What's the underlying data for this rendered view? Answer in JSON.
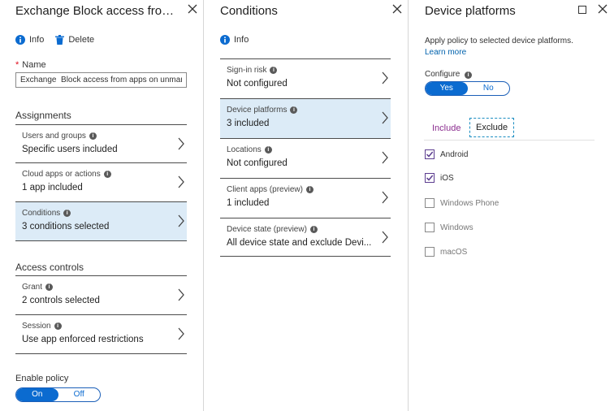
{
  "blade1": {
    "title": "Exchange Block access from a...",
    "commands": {
      "info": "Info",
      "delete": "Delete"
    },
    "name_label": "Name",
    "name_value": "Exchange  Block access from apps on unman...",
    "assignments_header": "Assignments",
    "assignments": [
      {
        "label": "Users and groups",
        "value": "Specific users included"
      },
      {
        "label": "Cloud apps or actions",
        "value": "1 app included"
      },
      {
        "label": "Conditions",
        "value": "3 conditions selected"
      }
    ],
    "access_header": "Access controls",
    "access": [
      {
        "label": "Grant",
        "value": "2 controls selected"
      },
      {
        "label": "Session",
        "value": "Use app enforced restrictions"
      }
    ],
    "enable_label": "Enable policy",
    "toggle": {
      "on": "On",
      "off": "Off"
    }
  },
  "blade2": {
    "title": "Conditions",
    "commands": {
      "info": "Info"
    },
    "rows": [
      {
        "label": "Sign-in risk",
        "value": "Not configured"
      },
      {
        "label": "Device platforms",
        "value": "3 included"
      },
      {
        "label": "Locations",
        "value": "Not configured"
      },
      {
        "label": "Client apps (preview)",
        "value": "1 included"
      },
      {
        "label": "Device state (preview)",
        "value": "All device state and exclude Devi..."
      }
    ]
  },
  "blade3": {
    "title": "Device platforms",
    "description": "Apply policy to selected device platforms.",
    "learn_more": "Learn more",
    "configure_label": "Configure",
    "toggle": {
      "yes": "Yes",
      "no": "No"
    },
    "tabs": {
      "include": "Include",
      "exclude": "Exclude"
    },
    "platforms": [
      {
        "label": "Android",
        "checked": true
      },
      {
        "label": "iOS",
        "checked": true
      },
      {
        "label": "Windows Phone",
        "checked": false
      },
      {
        "label": "Windows",
        "checked": false
      },
      {
        "label": "macOS",
        "checked": false
      }
    ]
  },
  "colors": {
    "accent": "#0b6bd0",
    "selected_row": "#dcebf7",
    "include_tab": "#8b2e8f",
    "required": "#e00b1c"
  }
}
